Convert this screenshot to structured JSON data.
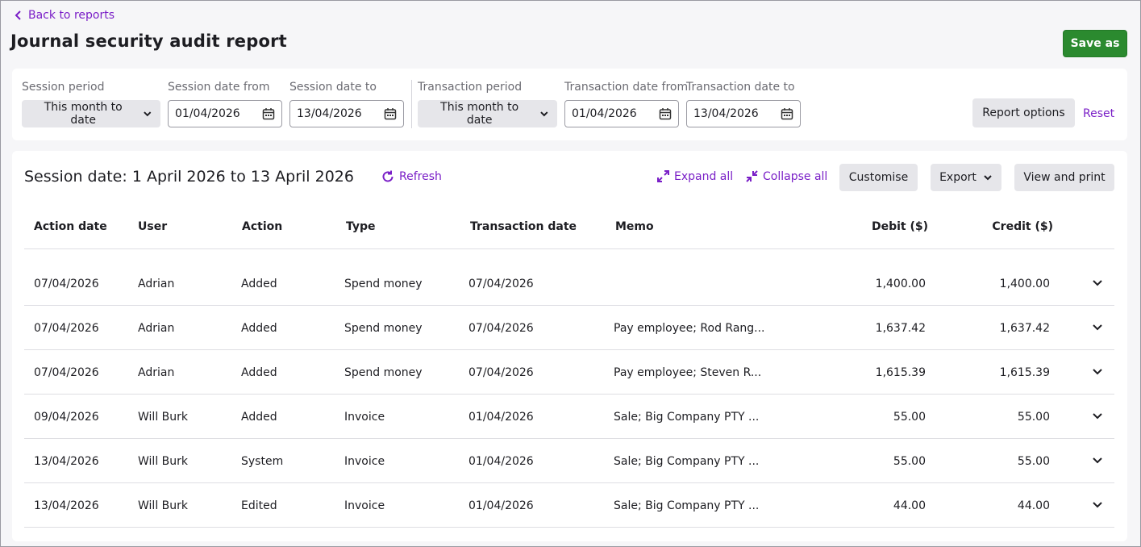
{
  "nav": {
    "back_label": "Back to reports"
  },
  "page": {
    "title": "Journal security audit report",
    "save_label": "Save as"
  },
  "filters": {
    "session_period": {
      "label": "Session period",
      "value": "This month to date"
    },
    "session_from": {
      "label": "Session date from",
      "value": "01/04/2026"
    },
    "session_to": {
      "label": "Session date to",
      "value": "13/04/2026"
    },
    "transaction_period": {
      "label": "Transaction period",
      "value": "This month to date"
    },
    "transaction_from": {
      "label": "Transaction date from",
      "value": "01/04/2026"
    },
    "transaction_to": {
      "label": "Transaction date to",
      "value": "13/04/2026"
    },
    "report_options_label": "Report options",
    "reset_label": "Reset"
  },
  "report": {
    "session_title": "Session date: 1 April 2026 to 13 April 2026",
    "refresh_label": "Refresh",
    "expand_all_label": "Expand all",
    "collapse_all_label": "Collapse all",
    "customise_label": "Customise",
    "export_label": "Export",
    "view_print_label": "View and print",
    "columns": [
      "Action date",
      "User",
      "Action",
      "Type",
      "Transaction date",
      "Memo",
      "Debit ($)",
      "Credit ($)"
    ],
    "rows": [
      {
        "action_date": "07/04/2026",
        "user": "Adrian",
        "action": "Added",
        "type": "Spend money",
        "transaction_date": "07/04/2026",
        "memo": "",
        "debit": "1,400.00",
        "credit": "1,400.00"
      },
      {
        "action_date": "07/04/2026",
        "user": "Adrian",
        "action": "Added",
        "type": "Spend money",
        "transaction_date": "07/04/2026",
        "memo": "Pay employee; Rod Rang...",
        "debit": "1,637.42",
        "credit": "1,637.42"
      },
      {
        "action_date": "07/04/2026",
        "user": "Adrian",
        "action": "Added",
        "type": "Spend money",
        "transaction_date": "07/04/2026",
        "memo": "Pay employee; Steven R...",
        "debit": "1,615.39",
        "credit": "1,615.39"
      },
      {
        "action_date": "09/04/2026",
        "user": "Will Burk",
        "action": "Added",
        "type": "Invoice",
        "transaction_date": "01/04/2026",
        "memo": "Sale; Big Company PTY ...",
        "debit": "55.00",
        "credit": "55.00"
      },
      {
        "action_date": "13/04/2026",
        "user": "Will Burk",
        "action": "System",
        "type": "Invoice",
        "transaction_date": "01/04/2026",
        "memo": "Sale; Big Company PTY ...",
        "debit": "55.00",
        "credit": "55.00"
      },
      {
        "action_date": "13/04/2026",
        "user": "Will Burk",
        "action": "Edited",
        "type": "Invoice",
        "transaction_date": "01/04/2026",
        "memo": "Sale; Big Company PTY ...",
        "debit": "44.00",
        "credit": "44.00"
      }
    ]
  },
  "colors": {
    "accent": "#7a1fc7",
    "primary_button": "#2b8a2f",
    "neutral_button": "#e6e6ea"
  }
}
